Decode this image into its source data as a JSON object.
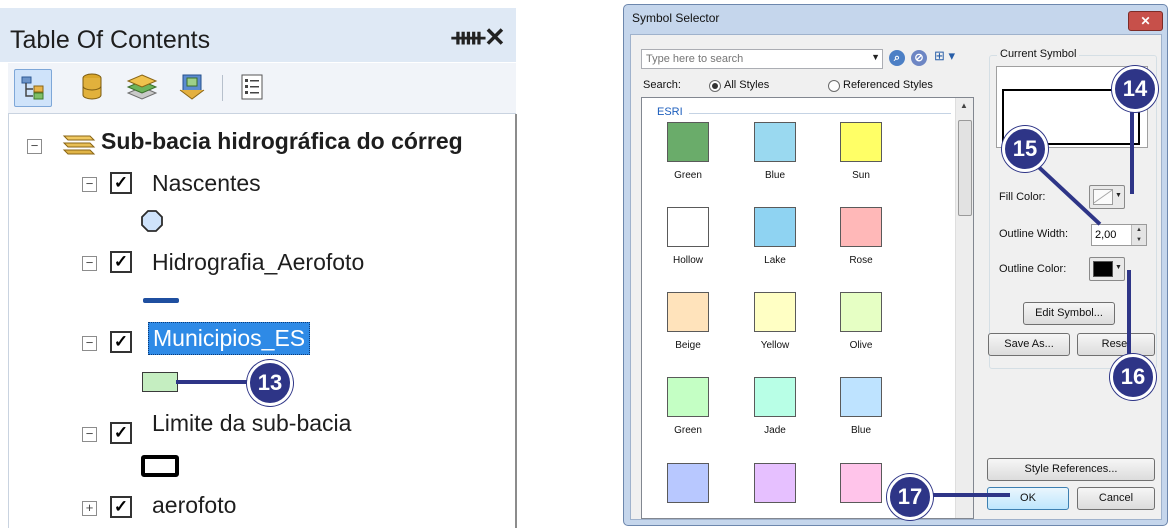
{
  "toc": {
    "title": "Table Of Contents",
    "pin_icon": "pin-icon",
    "close_icon": "close-icon",
    "toolbar": [
      "list-by-drawing-order-icon",
      "list-by-source-icon",
      "list-by-visibility-icon",
      "list-by-selection-icon",
      "options-icon"
    ],
    "data_frame": "Sub-bacia hidrográfica do córreg",
    "layers": [
      {
        "name": "Nascentes",
        "checked": true,
        "symbol": "point"
      },
      {
        "name": "Hidrografia_Aerofoto",
        "checked": true,
        "symbol": "line"
      },
      {
        "name": "Municipios_ES",
        "checked": true,
        "selected": true,
        "symbol": "polygon-fill"
      },
      {
        "name": "Limite da sub-bacia",
        "checked": true,
        "symbol": "polygon-outline"
      },
      {
        "name": "aerofoto",
        "checked": true,
        "expanded": false
      }
    ],
    "expander_minus": "−",
    "expander_plus": "+",
    "check_mark": "✓"
  },
  "callouts": {
    "c13": "13",
    "c14": "14",
    "c15": "15",
    "c16": "16",
    "c17": "17"
  },
  "dialog": {
    "title": "Symbol Selector",
    "close": "✕",
    "search_placeholder": "Type here to search",
    "search_label": "Search:",
    "radio_all": "All Styles",
    "radio_ref": "Referenced Styles",
    "group": "ESRI",
    "swatches": [
      {
        "label": "Green",
        "color": "#6aac6a"
      },
      {
        "label": "Blue",
        "color": "#9ad9f0"
      },
      {
        "label": "Sun",
        "color": "#ffff66"
      },
      {
        "label": "Hollow",
        "color": "#ffffff"
      },
      {
        "label": "Lake",
        "color": "#8fd3f2"
      },
      {
        "label": "Rose",
        "color": "#ffb8b8"
      },
      {
        "label": "Beige",
        "color": "#ffe3bb"
      },
      {
        "label": "Yellow",
        "color": "#ffffc4"
      },
      {
        "label": "Olive",
        "color": "#e6ffc4"
      },
      {
        "label": "Green",
        "color": "#c4ffc4"
      },
      {
        "label": "Jade",
        "color": "#b8ffe6"
      },
      {
        "label": "Blue",
        "color": "#bee3ff"
      },
      {
        "label": "",
        "color": "#b8c8ff"
      },
      {
        "label": "",
        "color": "#e6c0ff"
      },
      {
        "label": "",
        "color": "#ffc4ea"
      }
    ],
    "current_symbol": "Current Symbol",
    "fill_color_label": "Fill Color:",
    "outline_width_label": "Outline Width:",
    "outline_width_value": "2,00",
    "outline_color_label": "Outline Color:",
    "outline_color": "#000000",
    "edit_symbol": "Edit Symbol...",
    "save_as": "Save As...",
    "reset": "Reset",
    "style_references": "Style References...",
    "ok": "OK",
    "cancel": "Cancel"
  }
}
